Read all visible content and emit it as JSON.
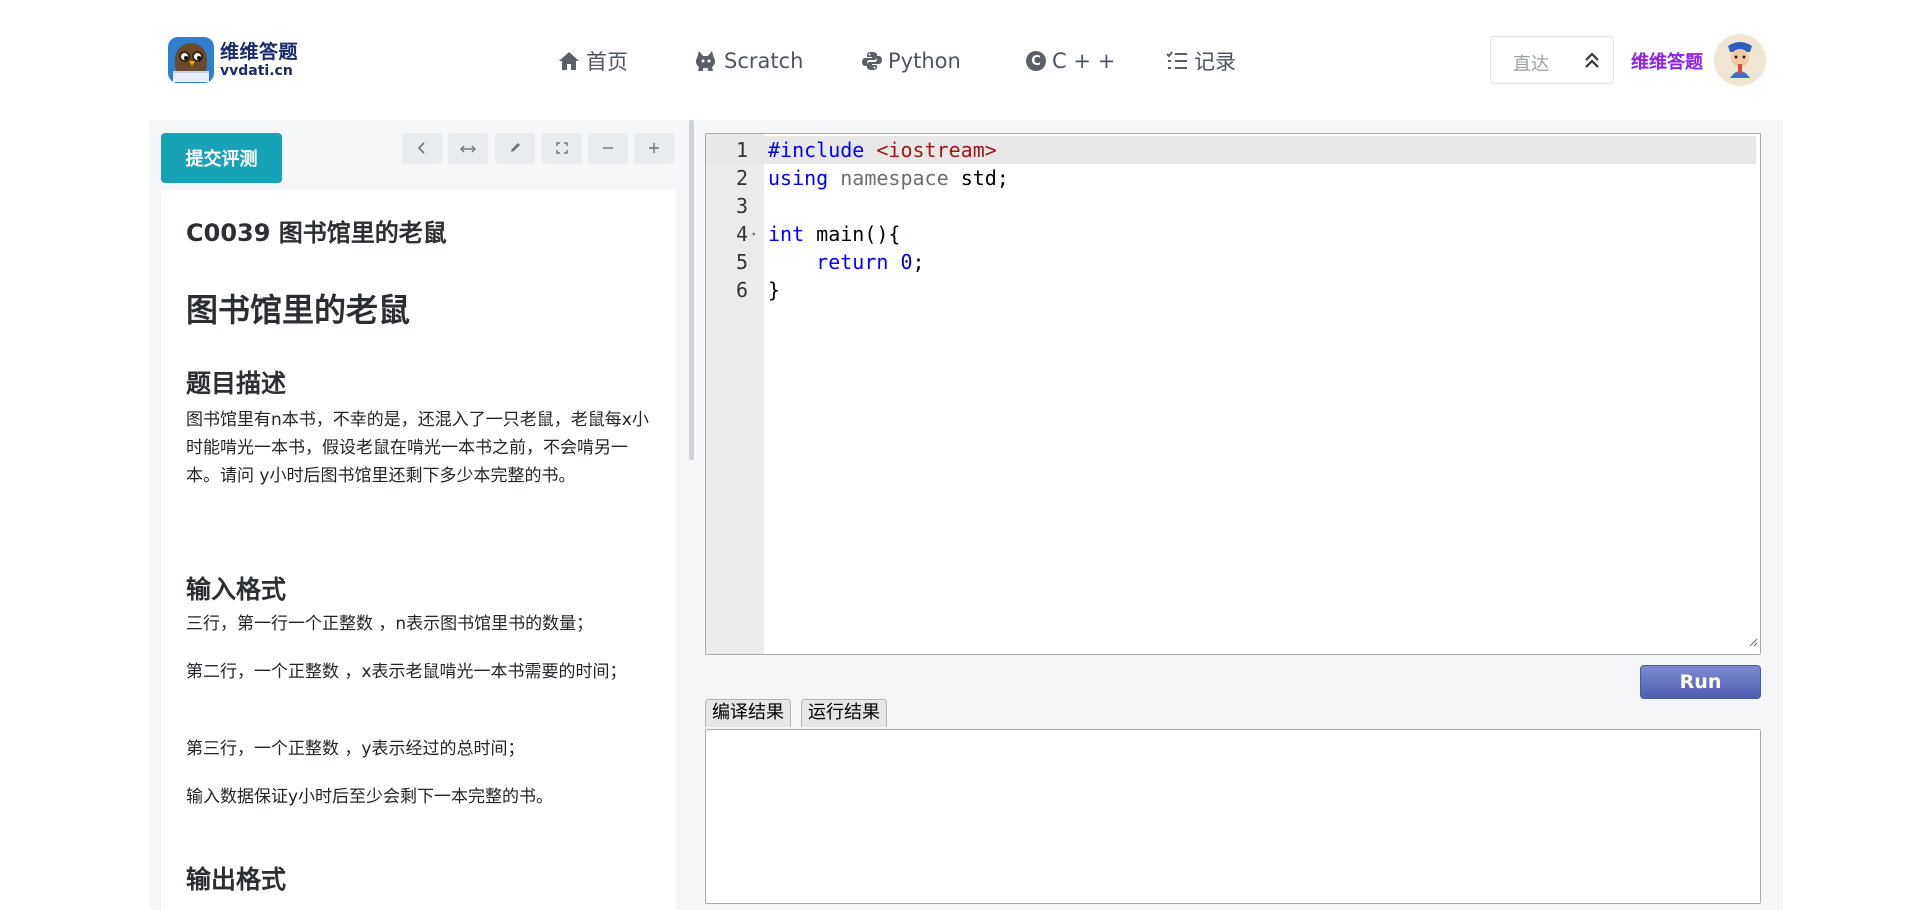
{
  "header": {
    "logo": {
      "cn": "维维答题",
      "en": "vvdati.cn"
    },
    "nav": [
      {
        "label": "首页",
        "icon": "home-icon"
      },
      {
        "label": "Scratch",
        "icon": "cat-icon"
      },
      {
        "label": "Python",
        "icon": "python-icon"
      },
      {
        "label": "C + +",
        "icon": "c-circle-icon"
      },
      {
        "label": "记录",
        "icon": "list-icon"
      }
    ],
    "jump": {
      "label": "直达"
    },
    "user_name": "维维答题"
  },
  "problem": {
    "submit_label": "提交评测",
    "toolbar_icons": [
      "chevron-left-icon",
      "expand-horizontal-icon",
      "pencil-icon",
      "fullscreen-icon",
      "minus-icon",
      "plus-icon"
    ],
    "code_title": "C0039 图书馆里的老鼠",
    "title": "图书馆里的老鼠",
    "desc_heading": "题目描述",
    "desc": "图书馆里有n本书，不幸的是，还混入了一只老鼠，老鼠每x小时能啃光一本书，假设老鼠在啃光一本书之前，不会啃另一本。请问 y小时后图书馆里还剩下多少本完整的书。",
    "input_heading": "输入格式",
    "input_lines": [
      "三行，第一行一个正整数 ，n表示图书馆里书的数量；",
      "第二行，一个正整数 ，x表示老鼠啃光一本书需要的时间；",
      "第三行，一个正整数 ，y表示经过的总时间；",
      "输入数据保证y小时后至少会剩下一本完整的书。"
    ],
    "output_heading": "输出格式"
  },
  "editor": {
    "line_numbers": [
      "1",
      "2",
      "3",
      "4",
      "5",
      "6"
    ],
    "code": {
      "l1_kw": "#include",
      "l1_str": "<iostream>",
      "l2_kw": "using",
      "l2_ns": "namespace",
      "l2_rest": "std;",
      "l4_kw": "int",
      "l4_rest": "main(){",
      "l5_kw": "return",
      "l5_num": "0",
      "l5_rest": ";",
      "l6": "}"
    },
    "run_label": "Run",
    "tabs": [
      "编译结果",
      "运行结果"
    ],
    "output": ""
  }
}
